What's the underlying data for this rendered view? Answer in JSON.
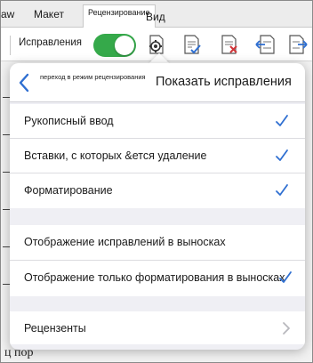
{
  "ribbon": {
    "tabs": [
      {
        "label": "aw"
      },
      {
        "label": "Макет"
      },
      {
        "label": "Рецензирование",
        "active": true
      },
      {
        "label": "Вид"
      }
    ]
  },
  "toolbar": {
    "track_changes_label": "Исправления",
    "track_changes_on": true,
    "icons": [
      "display-settings-icon",
      "accept-change-icon",
      "reject-change-icon",
      "previous-change-icon",
      "next-change-icon"
    ]
  },
  "popover": {
    "back_caption": "переход в режим рецензирования",
    "title": "Показать исправления",
    "section1": [
      {
        "label": "Рукописный ввод",
        "checked": true
      },
      {
        "label": "Вставки, с которых &ется удаление",
        "checked": true
      },
      {
        "label": "Форматирование",
        "checked": true
      }
    ],
    "section2": [
      {
        "label": "Отображение исправлений в выносках",
        "checked": false
      },
      {
        "label": "Отображение только форматирования в выносках",
        "checked": true
      }
    ],
    "section3": [
      {
        "label": "Рецензенты"
      }
    ]
  },
  "document": {
    "visible_fragment": "ц пор"
  },
  "colors": {
    "accent": "#2f6fd1",
    "toggle_on": "#35a94a",
    "icon_red": "#d13438"
  }
}
